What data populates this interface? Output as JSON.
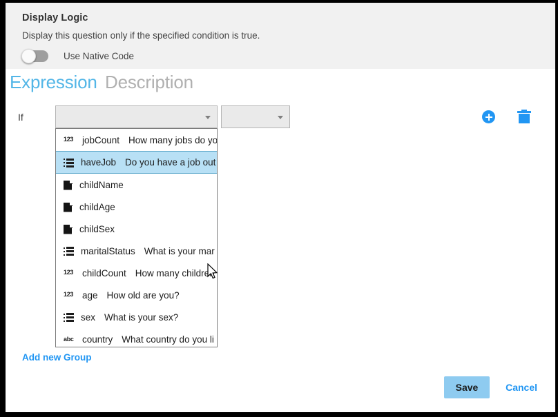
{
  "header": {
    "title": "Display Logic",
    "subtitle": "Display this question only if the specified condition is true.",
    "toggle_label": "Use Native Code",
    "toggle_state": "off"
  },
  "tabs": [
    {
      "label": "Expression",
      "active": true,
      "color": "#53b6e7"
    },
    {
      "label": "Description",
      "active": false,
      "color": "#b0b0b0"
    }
  ],
  "condition_row": {
    "if_label": "If",
    "field_select": {
      "value": "",
      "placeholder": ""
    },
    "operator_select": {
      "value": "",
      "placeholder": ""
    },
    "add_condition_icon": "plus-circle-icon",
    "delete_condition_icon": "trash-icon"
  },
  "dropdown": {
    "open": true,
    "selected_index": 1,
    "items": [
      {
        "icon": "numeric-123-icon",
        "name": "jobCount",
        "desc": "How many jobs do yo"
      },
      {
        "icon": "choice-list-icon",
        "name": "haveJob",
        "desc": "Do you have a job out"
      },
      {
        "icon": "text-page-icon",
        "name": "childName",
        "desc": ""
      },
      {
        "icon": "text-page-icon",
        "name": "childAge",
        "desc": ""
      },
      {
        "icon": "text-page-icon",
        "name": "childSex",
        "desc": ""
      },
      {
        "icon": "choice-list-icon",
        "name": "maritalStatus",
        "desc": "What is your mar"
      },
      {
        "icon": "numeric-123-icon",
        "name": "childCount",
        "desc": "How many children"
      },
      {
        "icon": "numeric-123-icon",
        "name": "age",
        "desc": "How old are you?"
      },
      {
        "icon": "choice-list-icon",
        "name": "sex",
        "desc": "What is your sex?"
      },
      {
        "icon": "string-abc-icon",
        "name": "country",
        "desc": "What country do you li"
      }
    ]
  },
  "add_group": {
    "label": "Add new Group",
    "color": "#2196f3"
  },
  "footer": {
    "save_label": "Save",
    "cancel_label": "Cancel",
    "save_color": "#8ecbf0",
    "cancel_color": "#2196f3"
  }
}
